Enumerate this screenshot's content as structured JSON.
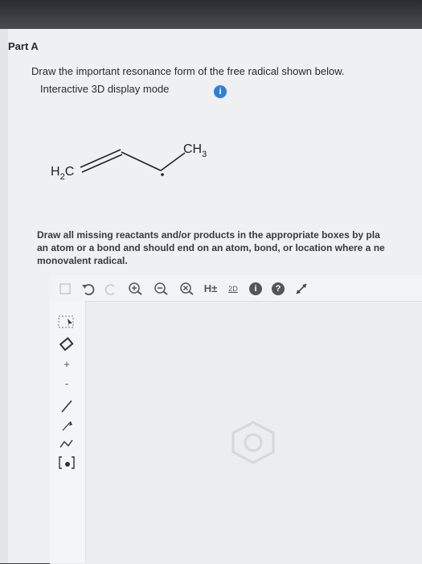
{
  "part": {
    "title": "Part A"
  },
  "question": {
    "prompt": "Draw the important resonance form of the free radical shown below.",
    "display_mode": "Interactive 3D display mode",
    "info_icon": "i"
  },
  "molecule": {
    "left_group_main": "H",
    "left_group_sub": "2",
    "left_group_tail": "C",
    "right_group_main": "CH",
    "right_group_sub": "3"
  },
  "instructions": {
    "line1": "Draw all missing reactants and/or products in the appropriate boxes by pla",
    "line2": "an atom or a bond and should end on an atom, bond, or location where a ne",
    "line3": "monovalent radical."
  },
  "toolbar": {
    "undo_icon": "undo-icon",
    "redo_icon": "redo-icon",
    "zoom_in_icon": "zoom-in-icon",
    "zoom_out_icon": "zoom-out-icon",
    "clear_icon": "clear-icon",
    "hydrogen_label": "H±",
    "mode_label": "2D",
    "info_label": "i",
    "help_label": "?"
  },
  "left_tools": {
    "plus_label": "+",
    "minus_label": "-"
  },
  "colors": {
    "info_blue": "#2e7fd6",
    "background": "#eef0f1"
  }
}
